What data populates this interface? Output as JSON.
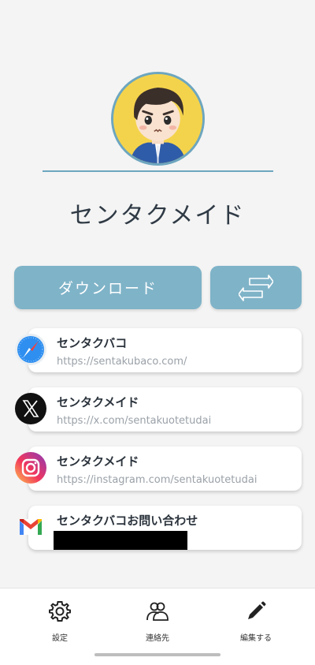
{
  "profile": {
    "name": "センタクメイド"
  },
  "actions": {
    "download_label": "ダウンロード",
    "switch_icon": "swap-arrows-icon"
  },
  "links": [
    {
      "icon": "safari-icon",
      "title": "センタクバコ",
      "url": "https://sentakubaco.com/"
    },
    {
      "icon": "x-icon",
      "title": "センタクメイド",
      "url": "https://x.com/sentakuotetudai"
    },
    {
      "icon": "instagram-icon",
      "title": "センタクメイド",
      "url": "https://instagram.com/sentakuotetudai"
    },
    {
      "icon": "gmail-icon",
      "title": "センタクバコお問い合わせ",
      "url_redacted": true
    }
  ],
  "tabbar": {
    "settings": "設定",
    "contacts": "連絡先",
    "edit": "編集する"
  },
  "colors": {
    "accent": "#7fb3c8",
    "accent_border": "#6da6bf",
    "avatar_bg": "#f4d34c",
    "background": "#f4f4f4"
  }
}
